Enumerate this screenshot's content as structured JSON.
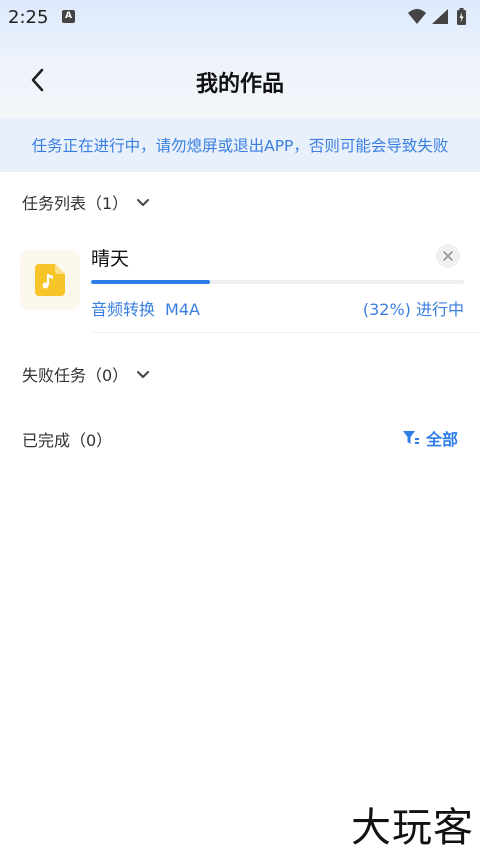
{
  "status_bar": {
    "time": "2:25",
    "notification_badge": "A",
    "icons": [
      "wifi-icon",
      "signal-icon",
      "battery-icon"
    ]
  },
  "nav": {
    "title": "我的作品",
    "back_icon": "back-arrow-icon"
  },
  "notice": {
    "text": "任务正在进行中，请勿熄屏或退出APP，否则可能会导致失败"
  },
  "sections": {
    "task_list_label": "任务列表（1）",
    "failed_label": "失败任务（0）",
    "completed_label": "已完成（0）"
  },
  "tasks": [
    {
      "name": "晴天",
      "type": "音频转换",
      "format": "M4A",
      "progress_percent": 32,
      "progress_text": "(32%) 进行中",
      "icon": "music-file-icon"
    }
  ],
  "filter": {
    "label": "全部",
    "icon": "filter-icon"
  },
  "watermark": {
    "text": "大玩客"
  },
  "colors": {
    "accent": "#2f7ee8",
    "notice_bg": "#e8f0fc",
    "notice_text": "#3a7fe0",
    "file_icon": "#f7c52a"
  }
}
